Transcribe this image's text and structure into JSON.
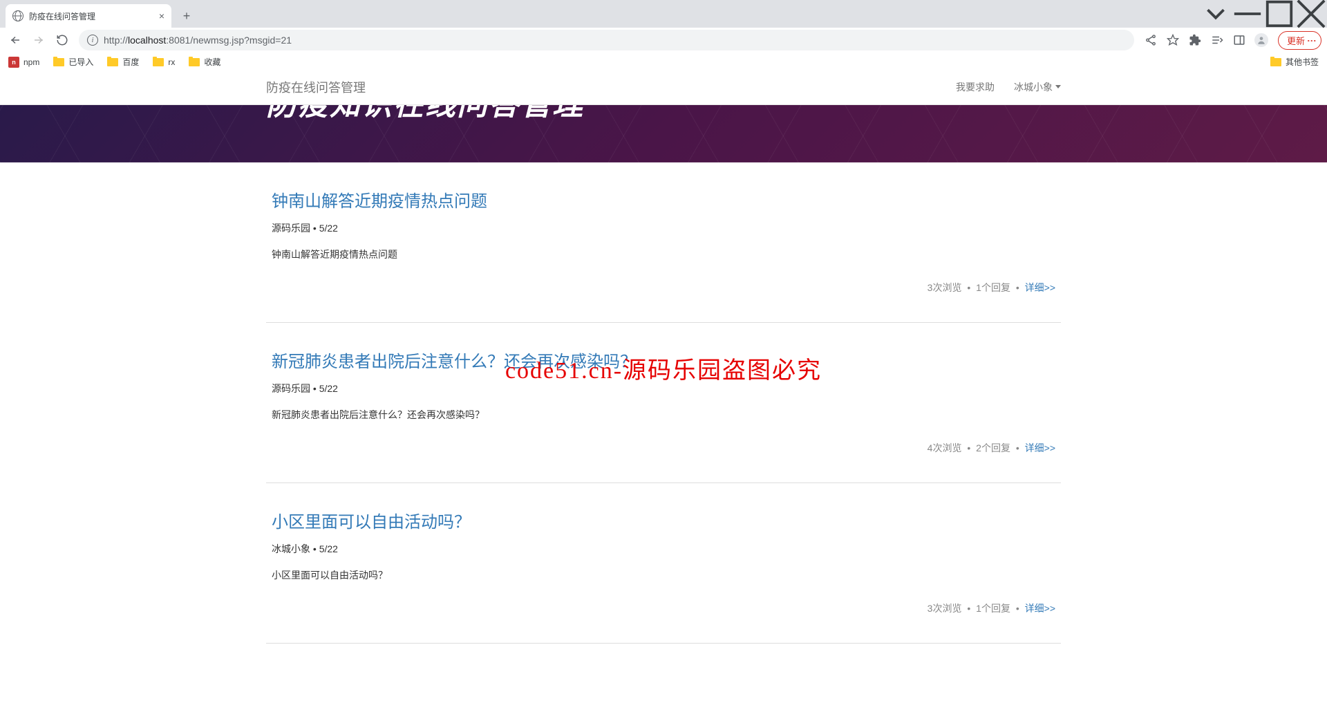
{
  "browser": {
    "tab_title": "防疫在线问答管理",
    "url_scheme": "http://",
    "url_host": "localhost",
    "url_port": ":8081",
    "url_path": "/newmsg.jsp?msgid=21",
    "update_label": "更新",
    "bookmarks": [
      {
        "icon": "npm",
        "label": "npm"
      },
      {
        "icon": "folder",
        "label": "已导入"
      },
      {
        "icon": "folder",
        "label": "百度"
      },
      {
        "icon": "folder",
        "label": "rx"
      },
      {
        "icon": "folder",
        "label": "收藏"
      }
    ],
    "other_bookmarks": "其他书签"
  },
  "navbar": {
    "brand": "防疫在线问答管理",
    "help_label": "我要求助",
    "user_label": "冰城小象"
  },
  "hero": {
    "title": "防疫知识在线问答管理"
  },
  "posts": [
    {
      "title": "钟南山解答近期疫情热点问题",
      "author": "源码乐园",
      "date": "5/22",
      "excerpt": "钟南山解答近期疫情热点问题",
      "views": "3次浏览",
      "replies": "1个回复",
      "detail": "详细>>"
    },
    {
      "title": "新冠肺炎患者出院后注意什么？还会再次感染吗？",
      "author": "源码乐园",
      "date": "5/22",
      "excerpt": "新冠肺炎患者出院后注意什么？还会再次感染吗？",
      "views": "4次浏览",
      "replies": "2个回复",
      "detail": "详细>>"
    },
    {
      "title": "小区里面可以自由活动吗？",
      "author": "冰城小象",
      "date": "5/22",
      "excerpt": "小区里面可以自由活动吗？",
      "views": "3次浏览",
      "replies": "1个回复",
      "detail": "详细>>"
    }
  ],
  "watermark": "code51.cn-源码乐园盗图必究",
  "sep": " • "
}
